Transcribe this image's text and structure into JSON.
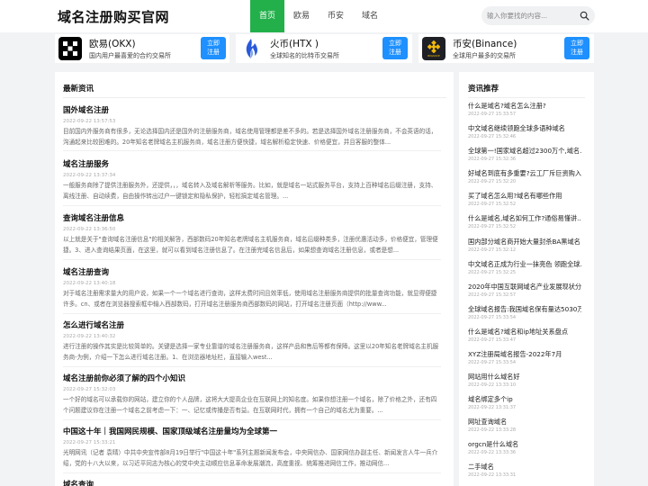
{
  "header": {
    "logo": "域名注册购买官网",
    "nav": [
      "首页",
      "欧易",
      "币安",
      "域名"
    ],
    "search_placeholder": "输入你要找的内容..."
  },
  "cards": [
    {
      "name": "欧易(OKX)",
      "desc": "国内用户最喜爱的合约交易所",
      "button_line1": "立即",
      "button_line2": "注册",
      "logo_icon": "okx-logo-icon"
    },
    {
      "name": "火币(HTX )",
      "desc": "全球知名的比特币交易所",
      "button_line1": "立即",
      "button_line2": "注册",
      "logo_icon": "htx-logo-icon"
    },
    {
      "name": "币安(Binance)",
      "desc": "全球用户最多的交易所",
      "button_line1": "立即",
      "button_line2": "注册",
      "logo_icon": "binance-logo-icon",
      "logo_text": "BINANCE"
    }
  ],
  "news": {
    "title": "最新资讯",
    "articles": [
      {
        "title": "国外域名注册",
        "date": "2022-09-22 13:57:53",
        "body": "目前国内外服务商有很多，无论选择国内还是国外的注册服务商，域名使用管理都是差不多的。若是选择国外域名注册服务商，不会英语的话，沟通起来比较困难的。20年知名老牌域名主机服务商，域名注册方便快捷，域名解析稳定快速、价格便宜，并且客服的整体..."
      },
      {
        "title": "域名注册服务",
        "date": "2022-09-22 13:37:34",
        "body": "一般服务商除了提供注册服务外，还提供，，，域名转入及域名解析等服务。比如，就是域名一站式服务平台，支持上百种域名后缀注册，支持、离线注册、自动续费，自由操作转出过户一键锁定和隐私保护，轻松搞定域名管理。..."
      },
      {
        "title": "查询域名注册信息",
        "date": "2022-09-22 13:36:50",
        "body": "以上就是关于\"查询域名注册信息\"的相关解答，西部数码20年知名老牌域名主机服务商，域名后缀种类多，注册优惠活动多，价格便宜，管理便捷。3、进入查询结果页面，在这里，就可以看到域名注册信息了。在注册完域名信息后，如果想查询域名注册信息，或者是想..."
      },
      {
        "title": "域名注册查询",
        "date": "2022-09-22 13:40:18",
        "body": "对于域名注册需求量大的用户说，如果一个一个域名进行查询，这样太费时间且效率低，使用域名注册服务商提供的批量查询功能，就显得便捷许多。cn、或者在浏览器搜索框中输入西部数码，打开域名注册服务商西部数码的网站，打开域名注册页面（http://www..."
      },
      {
        "title": "怎么进行域名注册",
        "date": "2022-09-22 13:40:32",
        "body": "进行注册的操作其实是比较简单的。关键是选择一家专业靠谱的域名注册服务商，这样产品和售后等都有保障。这里以20年知名老牌域名主机服务商-为例，介绍一下怎么进行域名注册。1、在浏览器地址栏，直接输入west..."
      },
      {
        "title": "域名注册前你必须了解的四个小知识",
        "date": "2022-09-27 15:32:03",
        "body": "一个好的域名可以承载你的网站，建立你的个人品牌，这将大大提高企业在互联网上的知名度。如果你想注册一个域名，除了价格之外，还有四个问题建议你在注册一个域名之前考虑一下：一、记忆或传播是否有益。在互联网时代，拥有一个自己的域名尤为重要。..."
      },
      {
        "title": "中国这十年｜我国网民规模、国家顶级域名注册量均为全球第一",
        "date": "2022-09-27 15:33:21",
        "body": "光明网讯（记者 袁晴）中共中央宣传部8月19日举行\"中国这十年\"系列主题新闻发布会，中央网信办、国家网信办副主任、新闻发言人牛一兵介绍，党的十八大以来，以习近平同志为核心的党中央主动顺应信息革命发展潮流，高度重视、统筹推进网信工作，推动网信..."
      },
      {
        "title": "域名查询",
        "date": "",
        "body": ""
      }
    ]
  },
  "sidebar": {
    "title": "资讯推荐",
    "items": [
      {
        "title": "什么是域名?域名怎么注册?",
        "date": "2022-09-27 15:33:57"
      },
      {
        "title": "中文域名继续领跑全球多语种域名",
        "date": "2022-09-27 15:32:46"
      },
      {
        "title": "全球第一!国家域名超过2300万个,域名...",
        "date": "2022-09-27 15:32:36"
      },
      {
        "title": "好域名到底有多重要?云工厂斥巨资购入...",
        "date": "2022-09-27 15:32:20"
      },
      {
        "title": "买了域名怎么用?域名有哪些作用",
        "date": "2022-09-27 15:32:52"
      },
      {
        "title": "什么是域名,域名如何工作?通俗易懂讲...",
        "date": "2022-09-27 15:32:52"
      },
      {
        "title": "国内部分域名商开始大量封杀BA黑域名",
        "date": "2022-09-27 15:32:12"
      },
      {
        "title": "中文域名正成为行业一抹亮色 领跑全球...",
        "date": "2022-09-27 15:32:25"
      },
      {
        "title": "2020年中国互联网域名产业发展现状分...",
        "date": "2022-09-27 15:32:57"
      },
      {
        "title": "全球域名报告:我国域名保有量达5030万...",
        "date": "2022-09-27 15:33:54"
      },
      {
        "title": "什么是域名?域名和ip地址关系盘点",
        "date": "2022-09-27 15:33:47"
      },
      {
        "title": "XYZ注册局域名报告-2022年7月",
        "date": "2022-09-27 15:33:54"
      },
      {
        "title": "网站用什么域名好",
        "date": "2022-09-22 13:33:10"
      },
      {
        "title": "域名绑定多个ip",
        "date": "2022-09-22 13:31:37"
      },
      {
        "title": "网址查询域名",
        "date": "2022-09-22 13:33:28"
      },
      {
        "title": "orgcn是什么域名",
        "date": "2022-09-22 13:33:36"
      },
      {
        "title": "二手域名",
        "date": "2022-09-22 13:33:31"
      }
    ]
  },
  "colors": {
    "accent_green": "#23b04b",
    "button_blue": "#1e90ff",
    "binance_yellow": "#f0b90b"
  }
}
